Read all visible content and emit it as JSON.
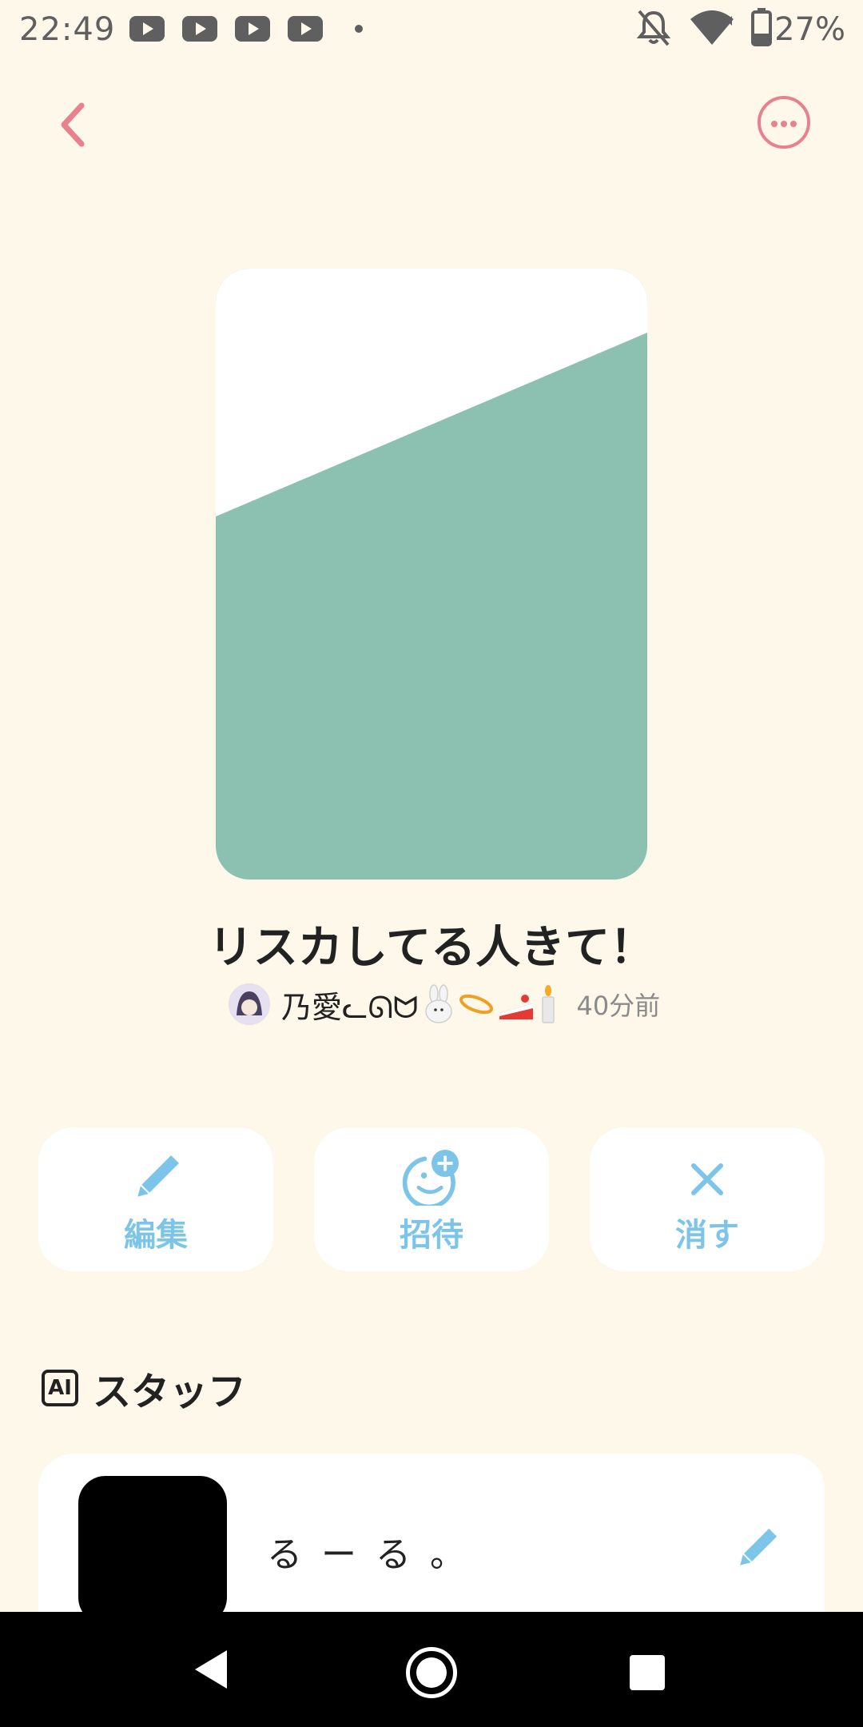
{
  "status_bar": {
    "time": "22:49",
    "notification_icons": [
      "youtube-icon",
      "youtube-icon",
      "youtube-icon",
      "youtube-icon"
    ],
    "battery": "27%"
  },
  "header": {
    "back_icon": "chevron-left-icon",
    "more_icon": "more-horizontal-icon",
    "accent_color": "#e8808e"
  },
  "room": {
    "title": "リスカしてる人きて！",
    "author_name": "乃愛ᓚᘏᗢ",
    "author_emoji_icons": [
      "rabbit-icon",
      "halo-icon",
      "cake-icon",
      "candle-icon"
    ],
    "time_ago": "40分前",
    "cover_color": "#8cc1b2"
  },
  "actions": {
    "edit_label": "編集",
    "invite_label": "招待",
    "delete_label": "消す",
    "icon_color": "#7dc5e8"
  },
  "staff_section": {
    "badge": "AI",
    "title": "スタッフ",
    "members": [
      {
        "name": "るーる。"
      }
    ]
  }
}
